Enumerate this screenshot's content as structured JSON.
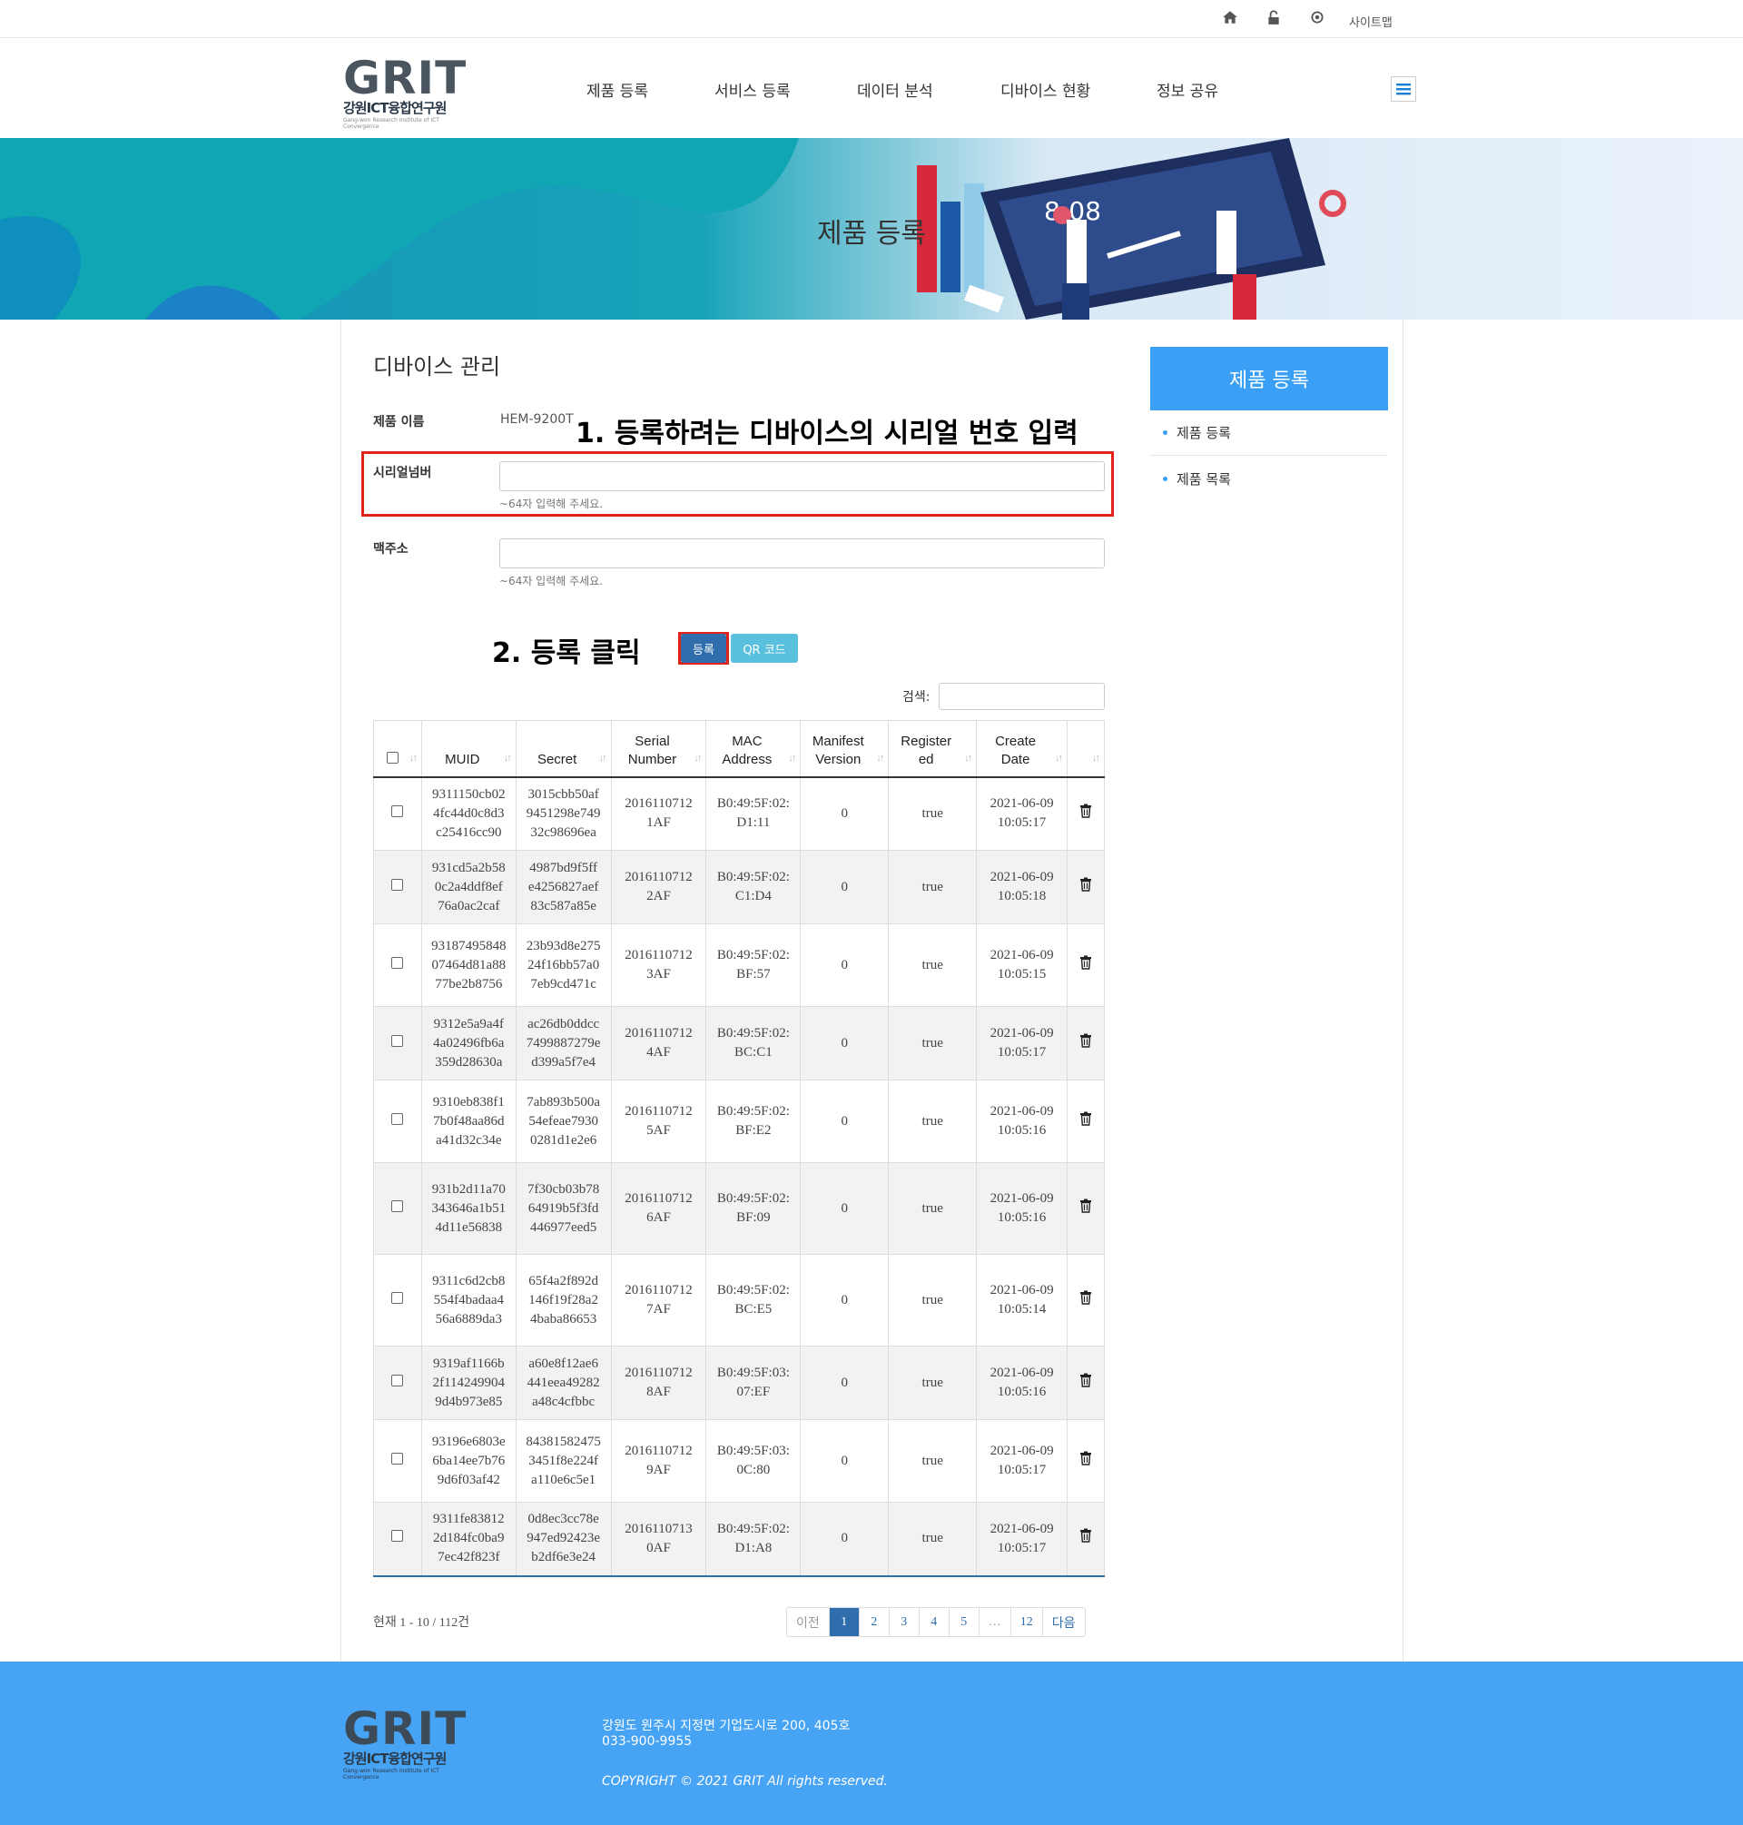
{
  "util_bar": {
    "icons": [
      "home-icon",
      "lock-icon",
      "gear-icon"
    ],
    "sitemap_label": "사이트맵"
  },
  "header": {
    "logo_word": "GRIT",
    "logo_kr": "강원ICT융합연구원",
    "logo_en": "Gang-won Research Institute of ICT Convergence",
    "nav": [
      "제품 등록",
      "서비스 등록",
      "데이터 분석",
      "디바이스 현황",
      "정보 공유"
    ]
  },
  "banner": {
    "title": "제품 등록"
  },
  "page": {
    "title": "디바이스 관리",
    "product_name_label": "제품 이름",
    "product_name_value": "HEM-9200T",
    "serial_label": "시리얼넘버",
    "serial_value": "",
    "serial_hint": "~64자 입력해 주세요.",
    "mac_label": "맥주소",
    "mac_value": "",
    "mac_hint": "~64자 입력해 주세요.",
    "annotation_1": "1. 등록하려는 디바이스의 시리얼 번호 입력",
    "annotation_2": "2. 등록 클릭",
    "register_button": "등록",
    "qr_button": "QR 코드",
    "search_label": "검색:"
  },
  "table": {
    "headers": [
      "MUID",
      "Secret",
      "Serial Number",
      "MAC Address",
      "Manifest Version",
      "Register ed",
      "Create Date"
    ],
    "rows": [
      {
        "muid": "9311150cb024fc44d0c8d3c25416cc90",
        "secret": "3015cbb50af9451298e74932c98696ea",
        "serial": "20161107121AF",
        "mac": "B0:49:5F:02:D1:11",
        "manifest": "0",
        "registered": "true",
        "date": "2021-06-09 10:05:17"
      },
      {
        "muid": "931cd5a2b580c2a4ddf8ef76a0ac2caf",
        "secret": "4987bd9f5ffe4256827aef83c587a85e",
        "serial": "20161107122AF",
        "mac": "B0:49:5F:02:C1:D4",
        "manifest": "0",
        "registered": "true",
        "date": "2021-06-09 10:05:18"
      },
      {
        "muid": "9318749584807464d81a8877be2b8756",
        "secret": "23b93d8e27524f16bb57a07eb9cd471c",
        "serial": "20161107123AF",
        "mac": "B0:49:5F:02:BF:57",
        "manifest": "0",
        "registered": "true",
        "date": "2021-06-09 10:05:15"
      },
      {
        "muid": "9312e5a9a4f4a02496fb6a359d28630a",
        "secret": "ac26db0ddcc7499887279ed399a5f7e4",
        "serial": "20161107124AF",
        "mac": "B0:49:5F:02:BC:C1",
        "manifest": "0",
        "registered": "true",
        "date": "2021-06-09 10:05:17"
      },
      {
        "muid": "9310eb838f17b0f48aa86da41d32c34e",
        "secret": "7ab893b500a54efeae79300281d1e2e6",
        "serial": "20161107125AF",
        "mac": "B0:49:5F:02:BF:E2",
        "manifest": "0",
        "registered": "true",
        "date": "2021-06-09 10:05:16"
      },
      {
        "muid": "931b2d11a70343646a1b514d11e56838",
        "secret": "7f30cb03b7864919b5f3fd446977eed5",
        "serial": "20161107126AF",
        "mac": "B0:49:5F:02:BF:09",
        "manifest": "0",
        "registered": "true",
        "date": "2021-06-09 10:05:16"
      },
      {
        "muid": "9311c6d2cb8554f4badaa456a6889da3",
        "secret": "65f4a2f892d146f19f28a24baba86653",
        "serial": "20161107127AF",
        "mac": "B0:49:5F:02:BC:E5",
        "manifest": "0",
        "registered": "true",
        "date": "2021-06-09 10:05:14"
      },
      {
        "muid": "9319af1166b2f1142499049d4b973e85",
        "secret": "a60e8f12ae6441eea49282a48c4cfbbc",
        "serial": "20161107128AF",
        "mac": "B0:49:5F:03:07:EF",
        "manifest": "0",
        "registered": "true",
        "date": "2021-06-09 10:05:16"
      },
      {
        "muid": "93196e6803e6ba14ee7b769d6f03af42",
        "secret": "843815824753451f8e224fa110e6c5e1",
        "serial": "20161107129AF",
        "mac": "B0:49:5F:03:0C:80",
        "manifest": "0",
        "registered": "true",
        "date": "2021-06-09 10:05:17"
      },
      {
        "muid": "9311fe838122d184fc0ba97ec42f823f",
        "secret": "0d8ec3cc78e947ed92423eb2df6e3e24",
        "serial": "20161107130AF",
        "mac": "B0:49:5F:02:D1:A8",
        "manifest": "0",
        "registered": "true",
        "date": "2021-06-09 10:05:17"
      }
    ],
    "page_info": "현재 1 - 10 / 112건",
    "pager": [
      "이전",
      "1",
      "2",
      "3",
      "4",
      "5",
      "…",
      "12",
      "다음"
    ],
    "active_page": "1"
  },
  "sidebar": {
    "title": "제품 등록",
    "items": [
      "제품 등록",
      "제품 목록"
    ]
  },
  "footer": {
    "address": "강원도 원주시 지정면 기업도시로 200, 405호",
    "phone": "033-900-9955",
    "copyright": "COPYRIGHT © 2021 GRIT All rights reserved."
  },
  "colors": {
    "accent": "#3aa0f5",
    "primary_button": "#2f6dac",
    "qr_button": "#5bc0de",
    "annotation_red": "#e0241b",
    "footer_bg": "#47a3f3"
  }
}
